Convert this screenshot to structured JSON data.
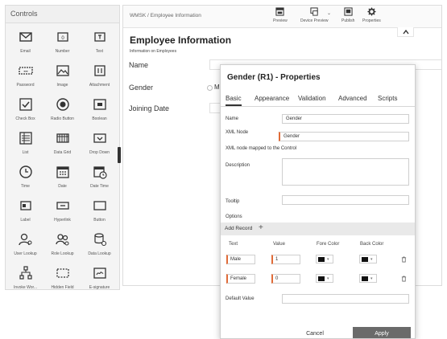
{
  "controls": {
    "title": "Controls",
    "items": [
      {
        "label": "Email",
        "icon": "email-icon"
      },
      {
        "label": "Number",
        "icon": "number-icon"
      },
      {
        "label": "Text",
        "icon": "text-icon"
      },
      {
        "label": "Password",
        "icon": "password-icon"
      },
      {
        "label": "Image",
        "icon": "image-icon"
      },
      {
        "label": "Attachment",
        "icon": "attachment-icon"
      },
      {
        "label": "Check Box",
        "icon": "checkbox-icon"
      },
      {
        "label": "Radio Button",
        "icon": "radio-button-icon"
      },
      {
        "label": "Boolean",
        "icon": "boolean-icon"
      },
      {
        "label": "List",
        "icon": "list-icon"
      },
      {
        "label": "Data Grid",
        "icon": "data-grid-icon"
      },
      {
        "label": "Drop Down",
        "icon": "dropdown-icon"
      },
      {
        "label": "Time",
        "icon": "clock-icon"
      },
      {
        "label": "Date",
        "icon": "calendar-icon"
      },
      {
        "label": "Date Time",
        "icon": "calendar-clock-icon"
      },
      {
        "label": "Label",
        "icon": "label-icon"
      },
      {
        "label": "Hyperlink",
        "icon": "hyperlink-icon"
      },
      {
        "label": "Button",
        "icon": "button-icon"
      },
      {
        "label": "User Lookup",
        "icon": "user-lookup-icon"
      },
      {
        "label": "Role Lookup",
        "icon": "role-lookup-icon"
      },
      {
        "label": "Data Lookup",
        "icon": "data-lookup-icon"
      },
      {
        "label": "Invoke Wor...",
        "icon": "invoke-workflow-icon"
      },
      {
        "label": "Hidden Field",
        "icon": "hidden-field-icon"
      },
      {
        "label": "E-signature",
        "icon": "signature-icon"
      }
    ]
  },
  "designer": {
    "breadcrumb": "WMSK / Employee Information",
    "toolbar": {
      "preview": "Preview",
      "device_preview": "Device Preview",
      "publish": "Publish",
      "properties": "Properties"
    },
    "form_title": "Employee Information",
    "form_subtitle": "Information on Employees",
    "fields": {
      "name": "Name",
      "gender": "Gender",
      "gender_option_partial": "M",
      "joining_date": "Joining Date"
    }
  },
  "properties": {
    "title": "Gender (R1) - Properties",
    "tabs": [
      "Basic",
      "Appearance",
      "Validation",
      "Advanced",
      "Scripts"
    ],
    "active_tab": "Basic",
    "labels": {
      "name": "Name",
      "xml_node": "XML Node",
      "xml_note": "XML node mapped to the Control",
      "description": "Description",
      "tooltip": "Tooltip",
      "options": "Options",
      "default_value": "Default Value"
    },
    "values": {
      "name": "Gender",
      "xml_node": "Gender",
      "description": "",
      "tooltip": "",
      "default_value": ""
    },
    "add_record": "Add Record",
    "columns": {
      "text": "Text",
      "value": "Value",
      "fore_color": "Fore Color",
      "back_color": "Back Color"
    },
    "records": [
      {
        "text": "Male",
        "value": "1",
        "fore_color": "#111111",
        "back_color": "#111111"
      },
      {
        "text": "Female",
        "value": "0",
        "fore_color": "#111111",
        "back_color": "#111111"
      }
    ],
    "cancel": "Cancel",
    "apply": "Apply"
  },
  "colors": {
    "required_marker": "#e06b38",
    "apply_button": "#6a6a6a",
    "panel_bg": "#f4f4f4"
  }
}
